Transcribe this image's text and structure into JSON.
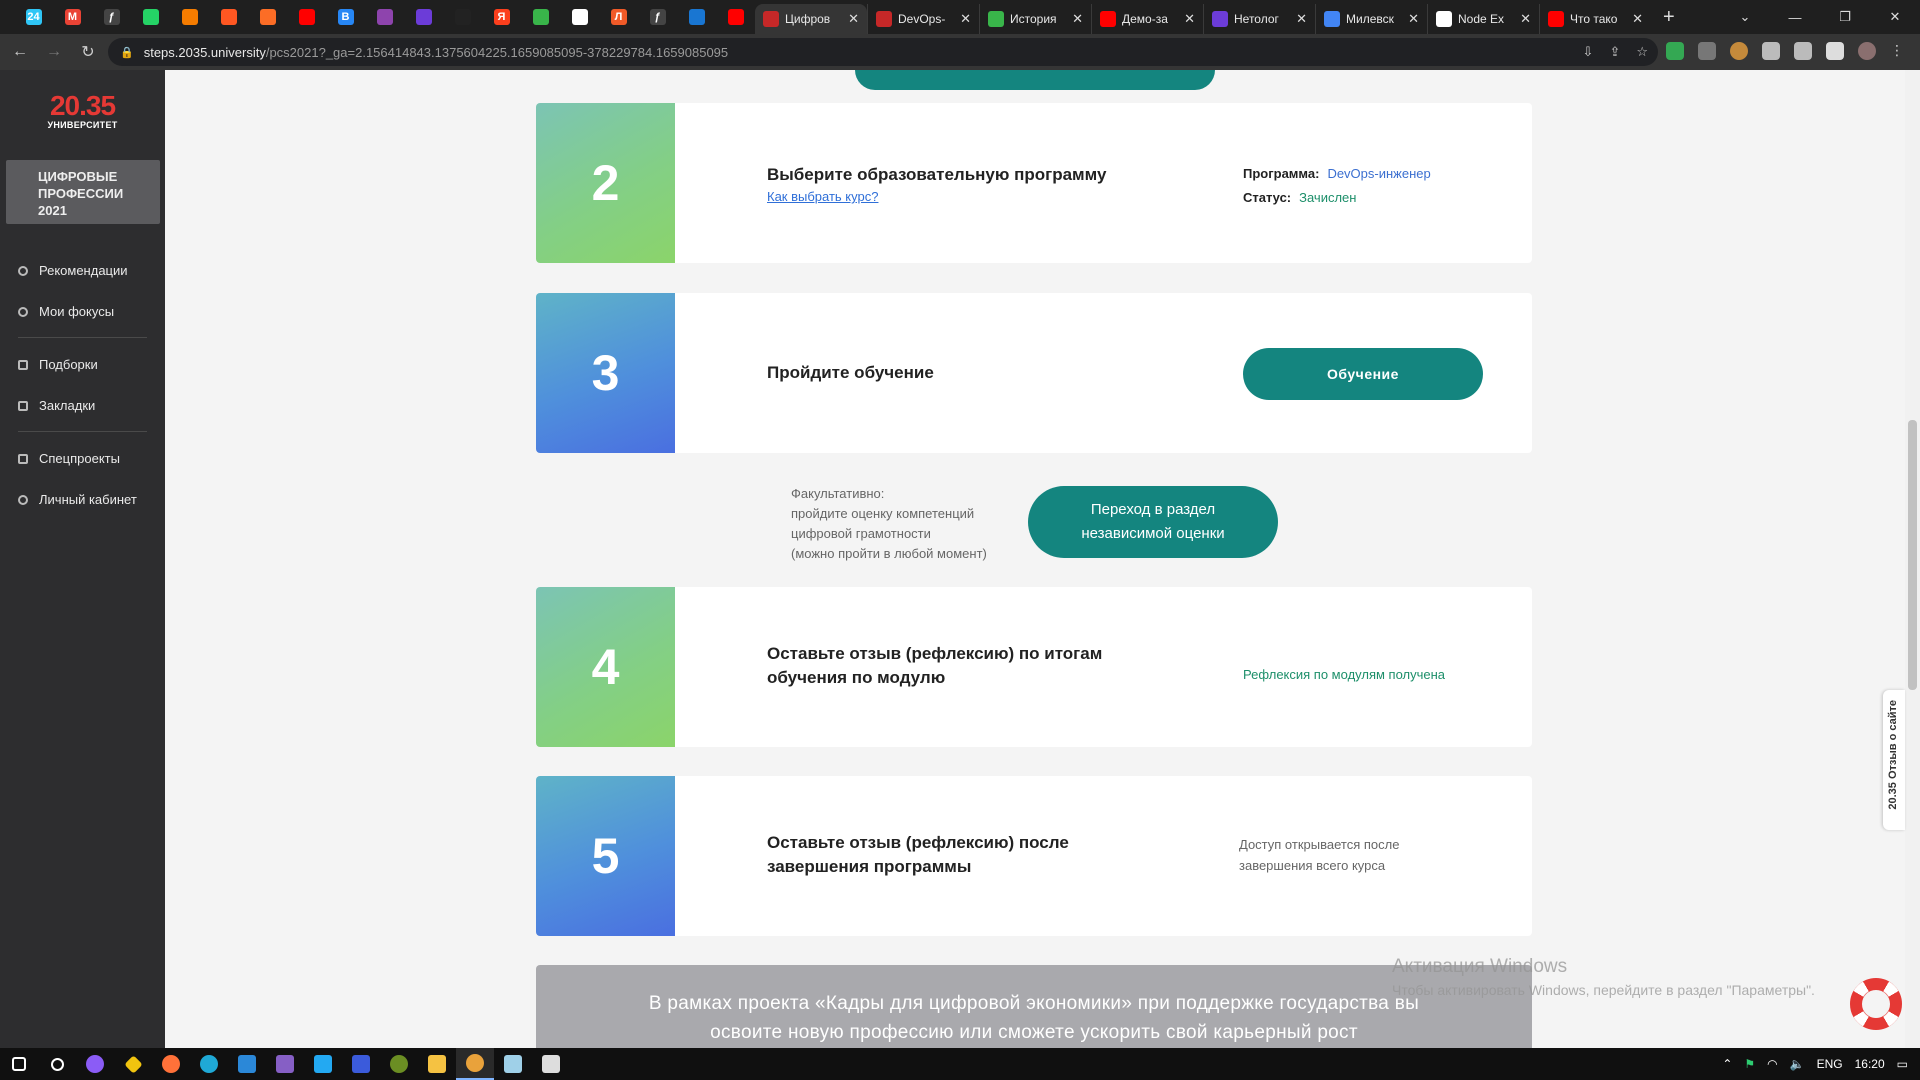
{
  "browser": {
    "pinned_tabs": [
      {
        "name": "bitrix24-tab",
        "color": "#2fc6f6",
        "glyph": "24"
      },
      {
        "name": "gmail-tab",
        "color": "#ea4335",
        "glyph": "M"
      },
      {
        "name": "yf-tab",
        "color": "#444",
        "glyph": "ƒ"
      },
      {
        "name": "whatsapp-tab",
        "color": "#25d366",
        "glyph": ""
      },
      {
        "name": "app-tab",
        "color": "#f57c00",
        "glyph": ""
      },
      {
        "name": "habr-tab",
        "color": "#ff5722",
        "glyph": ""
      },
      {
        "name": "gitlab-tab",
        "color": "#fc6d26",
        "glyph": ""
      },
      {
        "name": "youtube-tab",
        "color": "#ff0000",
        "glyph": ""
      },
      {
        "name": "vk-tab",
        "color": "#2787f5",
        "glyph": "B"
      },
      {
        "name": "flower-tab-1",
        "color": "#8e44ad",
        "glyph": ""
      },
      {
        "name": "flower-tab-2",
        "color": "#6c3cd8",
        "glyph": ""
      },
      {
        "name": "github-tab",
        "color": "#222",
        "glyph": ""
      },
      {
        "name": "yandex-tab",
        "color": "#fc3f1d",
        "glyph": "Я"
      },
      {
        "name": "eye-tab",
        "color": "#39b54a",
        "glyph": ""
      },
      {
        "name": "globe-tab",
        "color": "#ffffff",
        "glyph": ""
      },
      {
        "name": "l-tab",
        "color": "#f05a28",
        "glyph": "Л"
      },
      {
        "name": "yf-tab-2",
        "color": "#444",
        "glyph": "ƒ"
      },
      {
        "name": "mail-tab",
        "color": "#1976d2",
        "glyph": ""
      },
      {
        "name": "youtube-tab-2",
        "color": "#ff0000",
        "glyph": ""
      }
    ],
    "tabs": [
      {
        "label": "Цифров",
        "fav": "#c62828",
        "active": true
      },
      {
        "label": "DevOps-",
        "fav": "#c62828",
        "active": false
      },
      {
        "label": "История",
        "fav": "#39b54a",
        "active": false
      },
      {
        "label": "Демо-за",
        "fav": "#ff0000",
        "active": false
      },
      {
        "label": "Нетолог",
        "fav": "#6c3cd8",
        "active": false
      },
      {
        "label": "Милевск",
        "fav": "#4285f4",
        "active": false
      },
      {
        "label": "Node Ex",
        "fav": "#ffffff",
        "active": false
      },
      {
        "label": "Что тако",
        "fav": "#ff0000",
        "active": false
      }
    ],
    "url_main": "steps.2035.university",
    "url_rest": "/pcs2021?_ga=2.156414843.1375604225.1659085095-378229784.1659085095"
  },
  "sidebar": {
    "logo_big": "20.35",
    "logo_small": "УНИВЕРСИТЕТ",
    "banner_lines": [
      "ЦИФРОВЫЕ",
      "ПРОФЕССИИ",
      "2021"
    ],
    "items": [
      {
        "label": "Рекомендации",
        "icon": "compass-icon"
      },
      {
        "label": "Мои фокусы",
        "icon": "target-icon"
      },
      {
        "label": "Подборки",
        "icon": "folder-icon"
      },
      {
        "label": "Закладки",
        "icon": "bookmark-icon"
      },
      {
        "label": "Спецпроекты",
        "icon": "flask-icon"
      },
      {
        "label": "Личный кабинет",
        "icon": "user-icon"
      }
    ]
  },
  "steps": [
    {
      "number": "2",
      "title": "Выберите образовательную программу",
      "link": "Как выбрать курс?",
      "program_label": "Программа:",
      "program_value": "DevOps-инженер",
      "status_label": "Статус:",
      "status_value": "Зачислен"
    },
    {
      "number": "3",
      "title": "Пройдите обучение",
      "button": "Обучение"
    },
    {
      "number": "4",
      "title_line1": "Оставьте отзыв (рефлексию) по итогам",
      "title_line2": "обучения по модулю",
      "status": "Рефлексия по модулям получена"
    },
    {
      "number": "5",
      "title_line1": "Оставьте отзыв (рефлексию) после",
      "title_line2": "завершения программы",
      "note_line1": "Доступ открывается после",
      "note_line2": "завершения всего курса"
    }
  ],
  "optional": {
    "line1": "Факультативно:",
    "line2": "пройдите оценку компетенций",
    "line3": "цифровой грамотности",
    "line4": "(можно пройти в любой момент)",
    "button_line1": "Переход в раздел",
    "button_line2": "независимой оценки"
  },
  "footer": {
    "line1": "В рамках проекта «Кадры для цифровой экономики» при поддержке государства вы",
    "line2": "освоите новую профессию или сможете ускорить свой карьерный рост"
  },
  "feedback_tab": "20.35 Отзыв о сайте",
  "watermark": {
    "title": "Активация Windows",
    "text": "Чтобы активировать Windows, перейдите в раздел \"Параметры\"."
  },
  "taskbar": {
    "lang": "ENG",
    "time": "16:20"
  },
  "colors": {
    "accent": "#14857f",
    "logo_red": "#e53935",
    "status_green": "#1d8f6a",
    "link_blue": "#2f6fd8"
  }
}
